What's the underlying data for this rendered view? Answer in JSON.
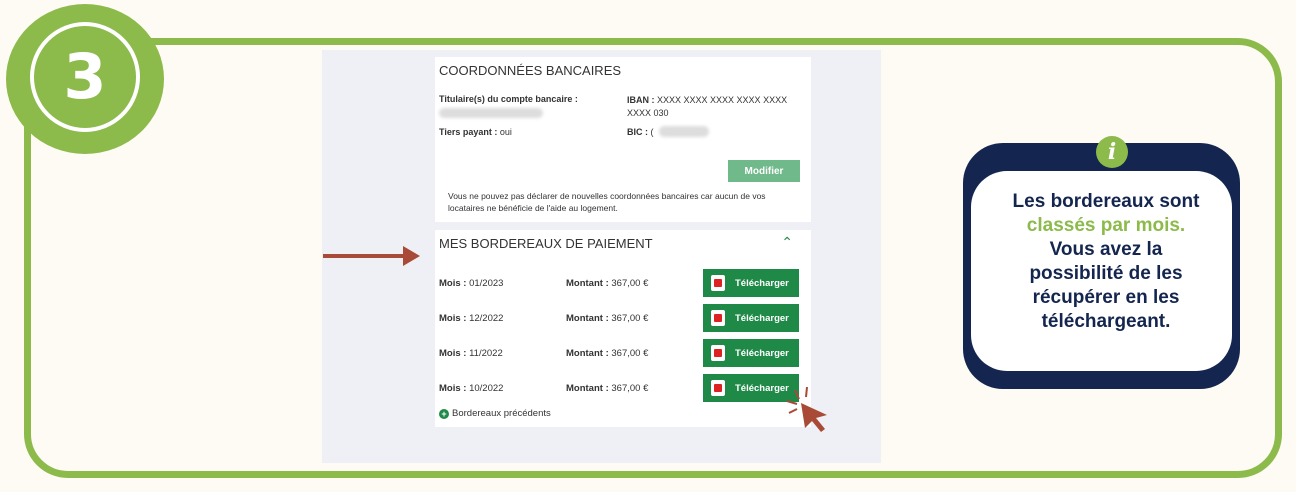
{
  "step": {
    "number": "3"
  },
  "coordonnees": {
    "title": "COORDONNÉES BANCAIRES",
    "titulaire_label": "Titulaire(s) du compte bancaire :",
    "iban_label": "IBAN :",
    "iban_value": "XXXX XXXX XXXX XXXX XXXX XXXX 030",
    "tiers_label": "Tiers payant :",
    "tiers_value": "oui",
    "bic_label": "BIC :",
    "bic_value": "(",
    "modifier_label": "Modifier",
    "note": "Vous ne pouvez pas déclarer de nouvelles coordonnées bancaires car aucun de vos locataires ne bénéficie de l'aide au logement."
  },
  "bordereaux": {
    "title": "MES BORDEREAUX DE PAIEMENT",
    "mois_label": "Mois :",
    "montant_label": "Montant :",
    "download_label": "Télécharger",
    "rows": [
      {
        "mois": "01/2023",
        "montant": "367,00 €"
      },
      {
        "mois": "12/2022",
        "montant": "367,00 €"
      },
      {
        "mois": "11/2022",
        "montant": "367,00 €"
      },
      {
        "mois": "10/2022",
        "montant": "367,00 €"
      }
    ],
    "previous_label": "Bordereaux précédents"
  },
  "info": {
    "line1": "Les bordereaux sont",
    "line2_green": "classés par mois.",
    "line3": "Vous avez la",
    "line4": "possibilité de les",
    "line5": "récupérer en les",
    "line6": "téléchargeant."
  },
  "colors": {
    "green": "#8cba4b",
    "navy": "#14264f",
    "button_green": "#1f8a48",
    "arrow": "#a84a35"
  }
}
